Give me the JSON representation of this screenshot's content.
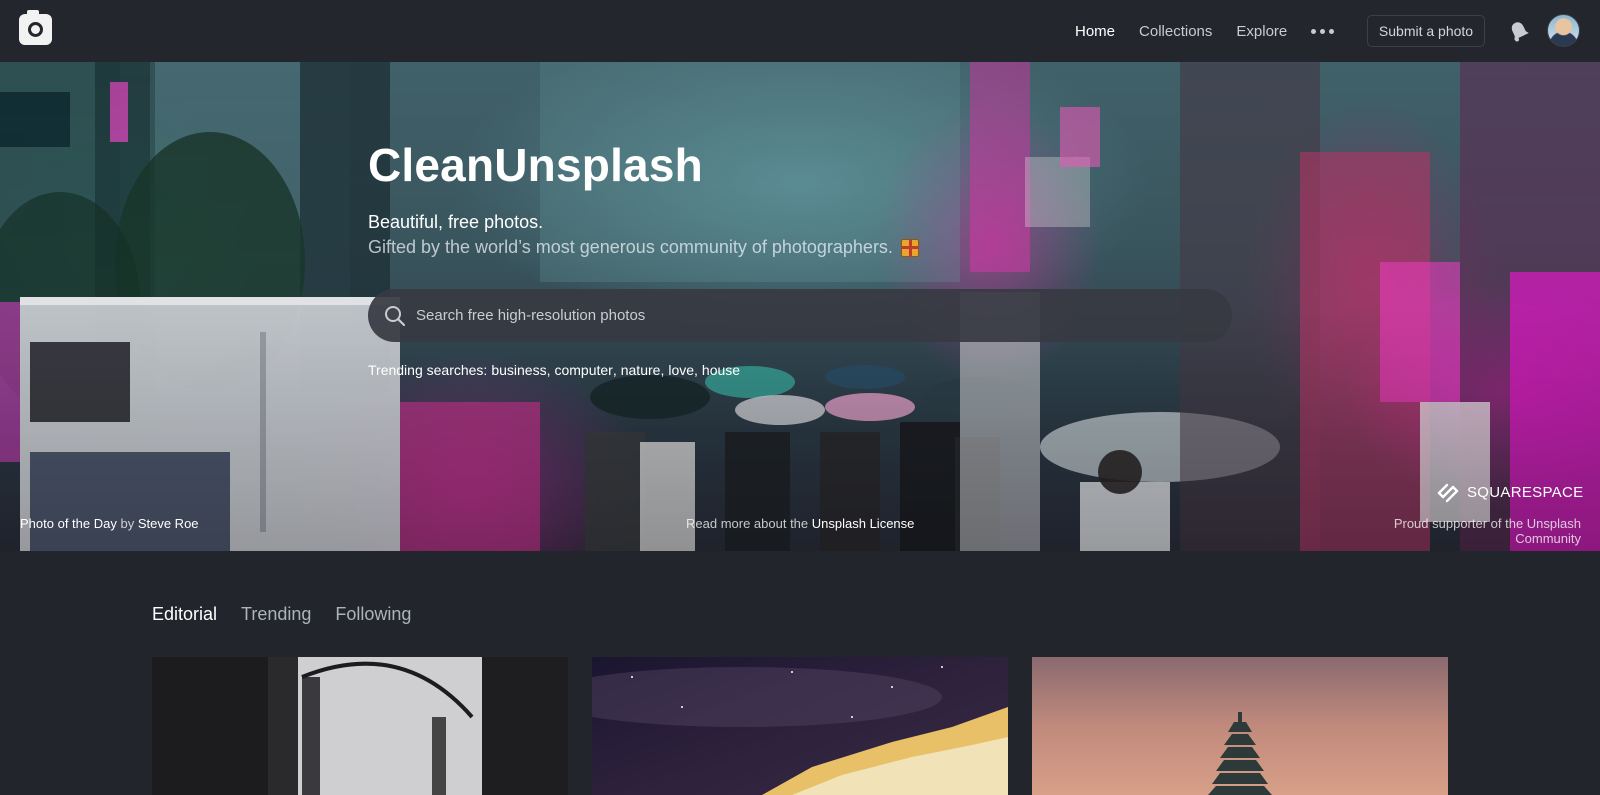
{
  "nav": {
    "logo_icon": "camera-icon",
    "links": [
      {
        "label": "Home",
        "active": true
      },
      {
        "label": "Collections",
        "active": false
      },
      {
        "label": "Explore",
        "active": false
      }
    ],
    "more_icon": "more-dots-icon",
    "submit_label": "Submit a photo",
    "notification_icon": "bell-icon",
    "avatar_icon": "user-avatar"
  },
  "hero": {
    "title": "CleanUnsplash",
    "subtitle": "Beautiful, free photos.",
    "tagline": "Gifted by the world’s most generous community of photographers.",
    "tagline_icon": "gift-icon",
    "search": {
      "placeholder": "Search free high-resolution photos",
      "value": ""
    },
    "trending_label": "Trending searches:",
    "trending": [
      "business",
      "computer",
      "nature",
      "love",
      "house"
    ],
    "photo_of_day_prefix": "Photo of the Day",
    "photo_of_day_by": "by",
    "photo_of_day_author": "Steve Roe",
    "license_prefix": "Read more about the",
    "license_link": "Unsplash License",
    "sponsor_name": "SQUARESPACE",
    "sponsor_text": "Proud supporter of the Unsplash Community"
  },
  "feed": {
    "tabs": [
      {
        "label": "Editorial",
        "active": true
      },
      {
        "label": "Trending",
        "active": false
      },
      {
        "label": "Following",
        "active": false
      }
    ]
  },
  "colors": {
    "background": "#22252c",
    "nav": "#23262d",
    "text_primary": "#ffffff",
    "text_muted": "#aeb2ba"
  }
}
